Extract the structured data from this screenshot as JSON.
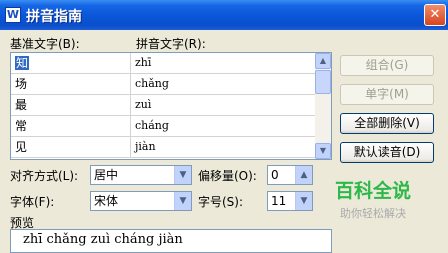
{
  "window": {
    "title": "拼音指南",
    "app_icon": "W",
    "close_label": "✕"
  },
  "labels": {
    "base_text": "基准文字(B):",
    "ruby_text": "拼音文字(R):"
  },
  "rows": [
    {
      "base": "知",
      "pinyin": "zhī",
      "selected": true
    },
    {
      "base": "场",
      "pinyin": "chǎng"
    },
    {
      "base": "最",
      "pinyin": "zuì"
    },
    {
      "base": "常",
      "pinyin": "cháng"
    },
    {
      "base": "见",
      "pinyin": "jiàn"
    }
  ],
  "buttons": {
    "group": "组合(G)",
    "single": "单字(M)",
    "clear_all": "全部删除(V)",
    "default_reading": "默认读音(D)"
  },
  "options": {
    "alignment_label": "对齐方式(L):",
    "alignment_value": "居中",
    "offset_label": "偏移量(O):",
    "offset_value": "0",
    "font_label": "字体(F):",
    "font_value": "宋体",
    "size_label": "字号(S):",
    "size_value": "11"
  },
  "preview": {
    "label": "预览",
    "text": "zhī chǎng zuì cháng jiàn"
  },
  "watermark": {
    "logo": "百科全说",
    "slogan": "助你轻松解决"
  }
}
